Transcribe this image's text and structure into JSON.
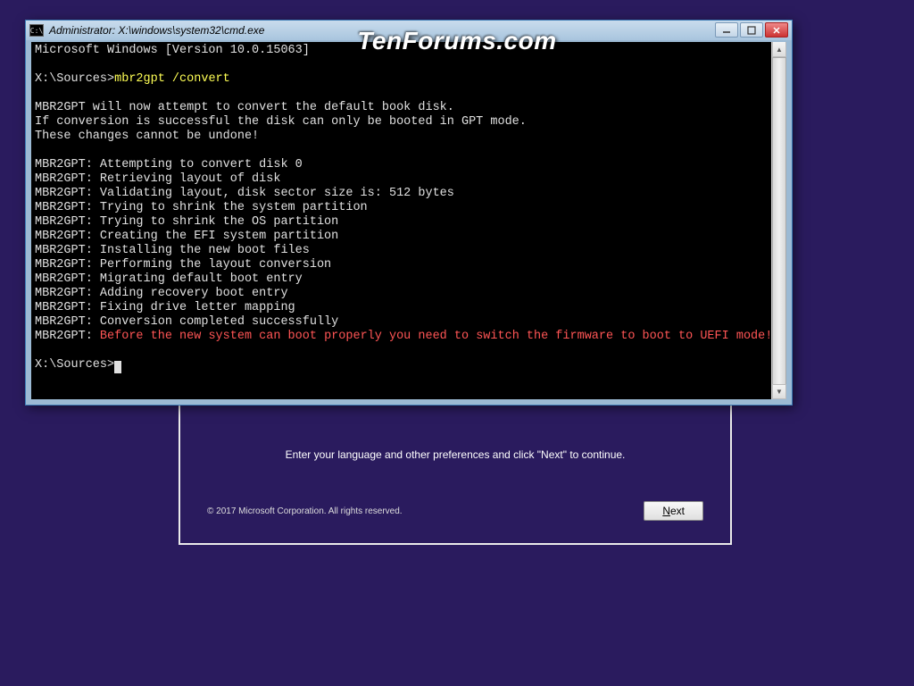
{
  "watermark": "TenForums.com",
  "setup": {
    "instruction": "Enter your language and other preferences and click \"Next\" to continue.",
    "copyright": "© 2017 Microsoft Corporation. All rights reserved.",
    "next_label_prefix": "",
    "next_label_u": "N",
    "next_label_rest": "ext"
  },
  "cmd": {
    "title": "Administrator: X:\\windows\\system32\\cmd.exe",
    "icon_text": "C:\\",
    "lines": {
      "l0": "Microsoft Windows [Version 10.0.15063]",
      "l1": "",
      "prompt1_path": "X:\\Sources>",
      "prompt1_cmd": "mbr2gpt /convert",
      "l3": "",
      "l4": "MBR2GPT will now attempt to convert the default book disk.",
      "l5": "If conversion is successful the disk can only be booted in GPT mode.",
      "l6": "These changes cannot be undone!",
      "l7": "",
      "l8": "MBR2GPT: Attempting to convert disk 0",
      "l9": "MBR2GPT: Retrieving layout of disk",
      "l10": "MBR2GPT: Validating layout, disk sector size is: 512 bytes",
      "l11": "MBR2GPT: Trying to shrink the system partition",
      "l12": "MBR2GPT: Trying to shrink the OS partition",
      "l13": "MBR2GPT: Creating the EFI system partition",
      "l14": "MBR2GPT: Installing the new boot files",
      "l15": "MBR2GPT: Performing the layout conversion",
      "l16": "MBR2GPT: Migrating default boot entry",
      "l17": "MBR2GPT: Adding recovery boot entry",
      "l18": "MBR2GPT: Fixing drive letter mapping",
      "l19": "MBR2GPT: Conversion completed successfully",
      "l20_prefix": "MBR2GPT: ",
      "l20_warn": "Before the new system can boot properly you need to switch the firmware to boot to UEFI mode!",
      "l21": "",
      "prompt2_path": "X:\\Sources>"
    }
  }
}
